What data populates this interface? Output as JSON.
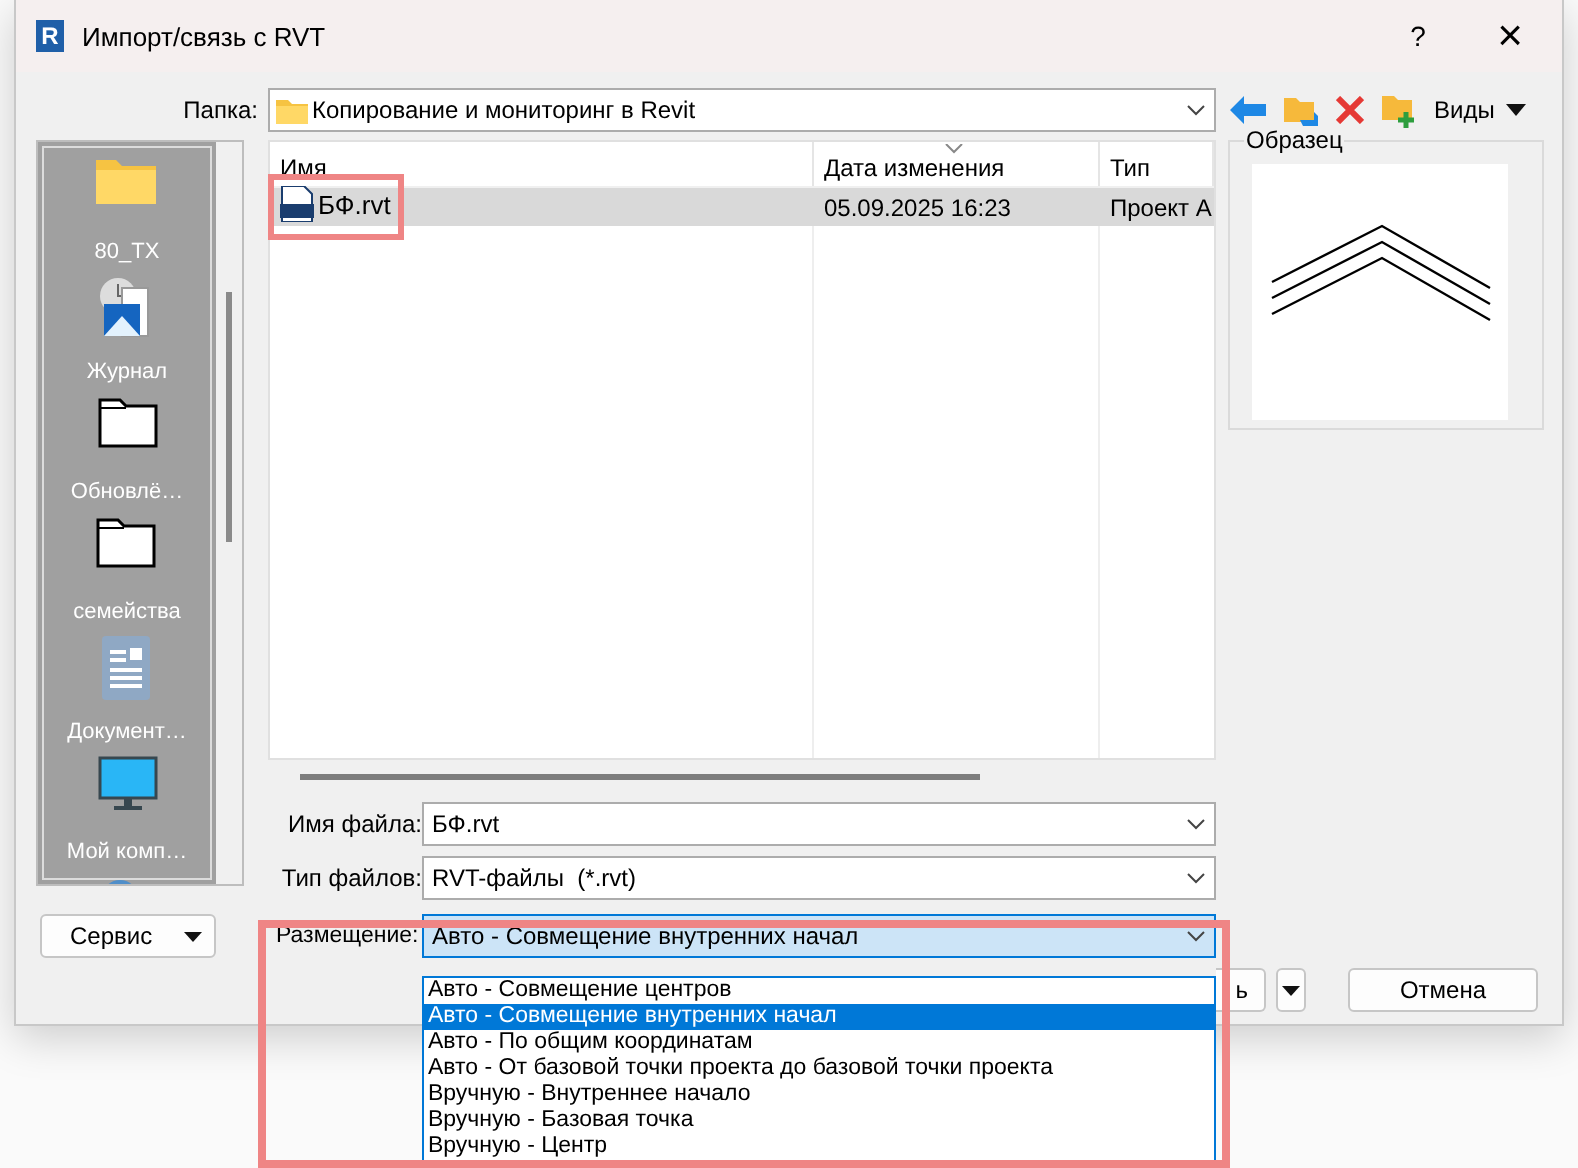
{
  "window": {
    "logo": "R",
    "title": "Импорт/связь с RVT",
    "help": "?",
    "close": "×"
  },
  "folder": {
    "label": "Папка:",
    "value": "Копирование и мониторинг в Revit"
  },
  "toolbar": {
    "views": "Виды"
  },
  "places": [
    {
      "kind": "folder",
      "label": "80_ТХ"
    },
    {
      "kind": "history",
      "label": "Журнал"
    },
    {
      "kind": "folder-outline",
      "label": "Обновлё…"
    },
    {
      "kind": "folder-outline",
      "label": "семейства"
    },
    {
      "kind": "document",
      "label": "Документ…"
    },
    {
      "kind": "monitor",
      "label": "Мой комп…"
    },
    {
      "kind": "network"
    }
  ],
  "file_list": {
    "columns": [
      "Имя",
      "Дата изменения",
      "Тип"
    ],
    "rows": [
      {
        "name": "БФ.rvt",
        "modified": "05.09.2025 16:23",
        "type": "Проект А",
        "selected": true,
        "highlighted": true
      }
    ]
  },
  "preview": {
    "title": "Образец"
  },
  "file_name": {
    "label": "Имя файла:",
    "value": "БФ.rvt"
  },
  "file_type": {
    "label": "Тип файлов:",
    "value": "RVT-файлы  (*.rvt)"
  },
  "service_button": "Сервис",
  "placement": {
    "label": "Размещение:",
    "value": "Авто - Совмещение внутренних начал",
    "expanded": true,
    "highlighted": true,
    "options": [
      {
        "label": "Авто - Совмещение центров",
        "selected": false
      },
      {
        "label": "Авто - Совмещение внутренних начал",
        "selected": true
      },
      {
        "label": "Авто - По общим координатам",
        "selected": false
      },
      {
        "label": "Авто - От базовой точки проекта до базовой точки проекта",
        "selected": false
      },
      {
        "label": "Вручную - Внутреннее начало",
        "selected": false
      },
      {
        "label": "Вручную - Базовая точка",
        "selected": false
      },
      {
        "label": "Вручную - Центр",
        "selected": false
      }
    ]
  },
  "open_button": "ь",
  "cancel_button": "Отмена"
}
